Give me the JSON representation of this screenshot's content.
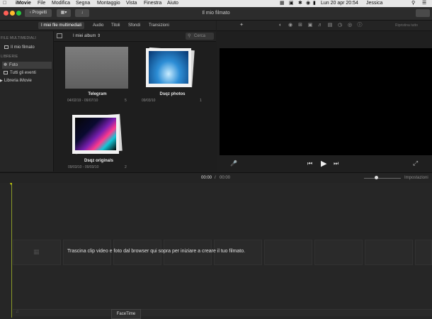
{
  "menubar": {
    "app_name": "iMovie",
    "menus": [
      "File",
      "Modifica",
      "Segna",
      "Montaggio",
      "Vista",
      "Finestra",
      "Aiuto"
    ],
    "clock": "Lun 20 apr  20:54",
    "user": "Jessica"
  },
  "titlebar": {
    "back_label": "Progetti",
    "window_title": "Il mio filmato"
  },
  "tabs": {
    "items": [
      "I miei file multimediali",
      "Audio",
      "Titoli",
      "Sfondi",
      "Transizioni"
    ],
    "active": "I miei file multimediali"
  },
  "sidebar": {
    "section_media": "FILE MULTIMEDIALI",
    "project_item": "Il mio filmato",
    "section_libraries": "LIBRERIE",
    "items": [
      {
        "label": "Foto",
        "selected": true
      },
      {
        "label": "Tutti gli eventi",
        "selected": false
      },
      {
        "label": "Libreria iMovie",
        "selected": false
      }
    ]
  },
  "browser": {
    "album_dropdown": "I miei album",
    "search_placeholder": "Cerca",
    "albums": [
      {
        "title": "Telegram",
        "dates": "04/02/19 - 09/07/10",
        "count": "5"
      },
      {
        "title": "Dsqz photos",
        "dates": "09/03/10",
        "count": "1"
      },
      {
        "title": "Dsqz originals",
        "dates": "09/03/10 - 09/03/10",
        "count": "2"
      }
    ]
  },
  "viewer": {
    "reset_label": "Ripristina tutto"
  },
  "timeline_header": {
    "current_time": "00:00",
    "separator": "/",
    "total_time": "00:00",
    "settings_label": "Impostazioni"
  },
  "timeline": {
    "hint": "Trascina clip video e foto dal browser qui sopra per iniziare a creare il tuo filmato."
  },
  "dock": {
    "tooltip": "FaceTime"
  },
  "colors": {
    "menubar": "#e6e6e6",
    "window_bg": "#1e1e1e",
    "playhead": "#c9d000",
    "traffic_red": "#fe5f57",
    "traffic_yellow": "#febc2e",
    "traffic_green": "#28c840"
  }
}
